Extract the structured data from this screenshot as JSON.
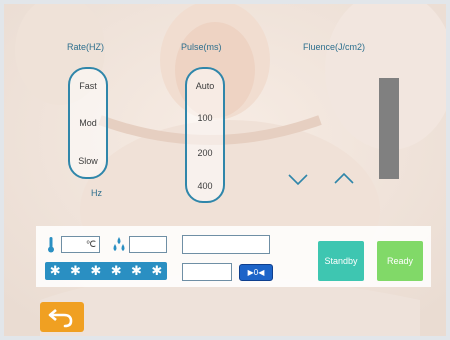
{
  "header": {
    "rate_label": "Rate(HZ)",
    "pulse_label": "Pulse(ms)",
    "fluence_label": "Fluence(J/cm2)"
  },
  "rate": {
    "options": [
      "Fast",
      "Mod",
      "Slow"
    ],
    "unit": "Hz"
  },
  "pulse": {
    "options": [
      "Auto",
      "100",
      "200",
      "400"
    ]
  },
  "status": {
    "temperature_unit": "℃",
    "level_stars": [
      "✱",
      "✱",
      "✱",
      "✱",
      "✱",
      "✱"
    ],
    "reset_label": "▶0◀"
  },
  "buttons": {
    "standby": "Standby",
    "ready": "Ready"
  },
  "colors": {
    "accent": "#2f86aa",
    "standby": "#3ec6b1",
    "ready": "#81d968",
    "back": "#f0a022",
    "fluence_bar": "#808080"
  },
  "icons": {
    "temperature": "thermometer-icon",
    "water": "water-drops-icon",
    "back": "back-arrow-icon",
    "decrease": "chevron-down-icon",
    "increase": "chevron-up-icon"
  }
}
